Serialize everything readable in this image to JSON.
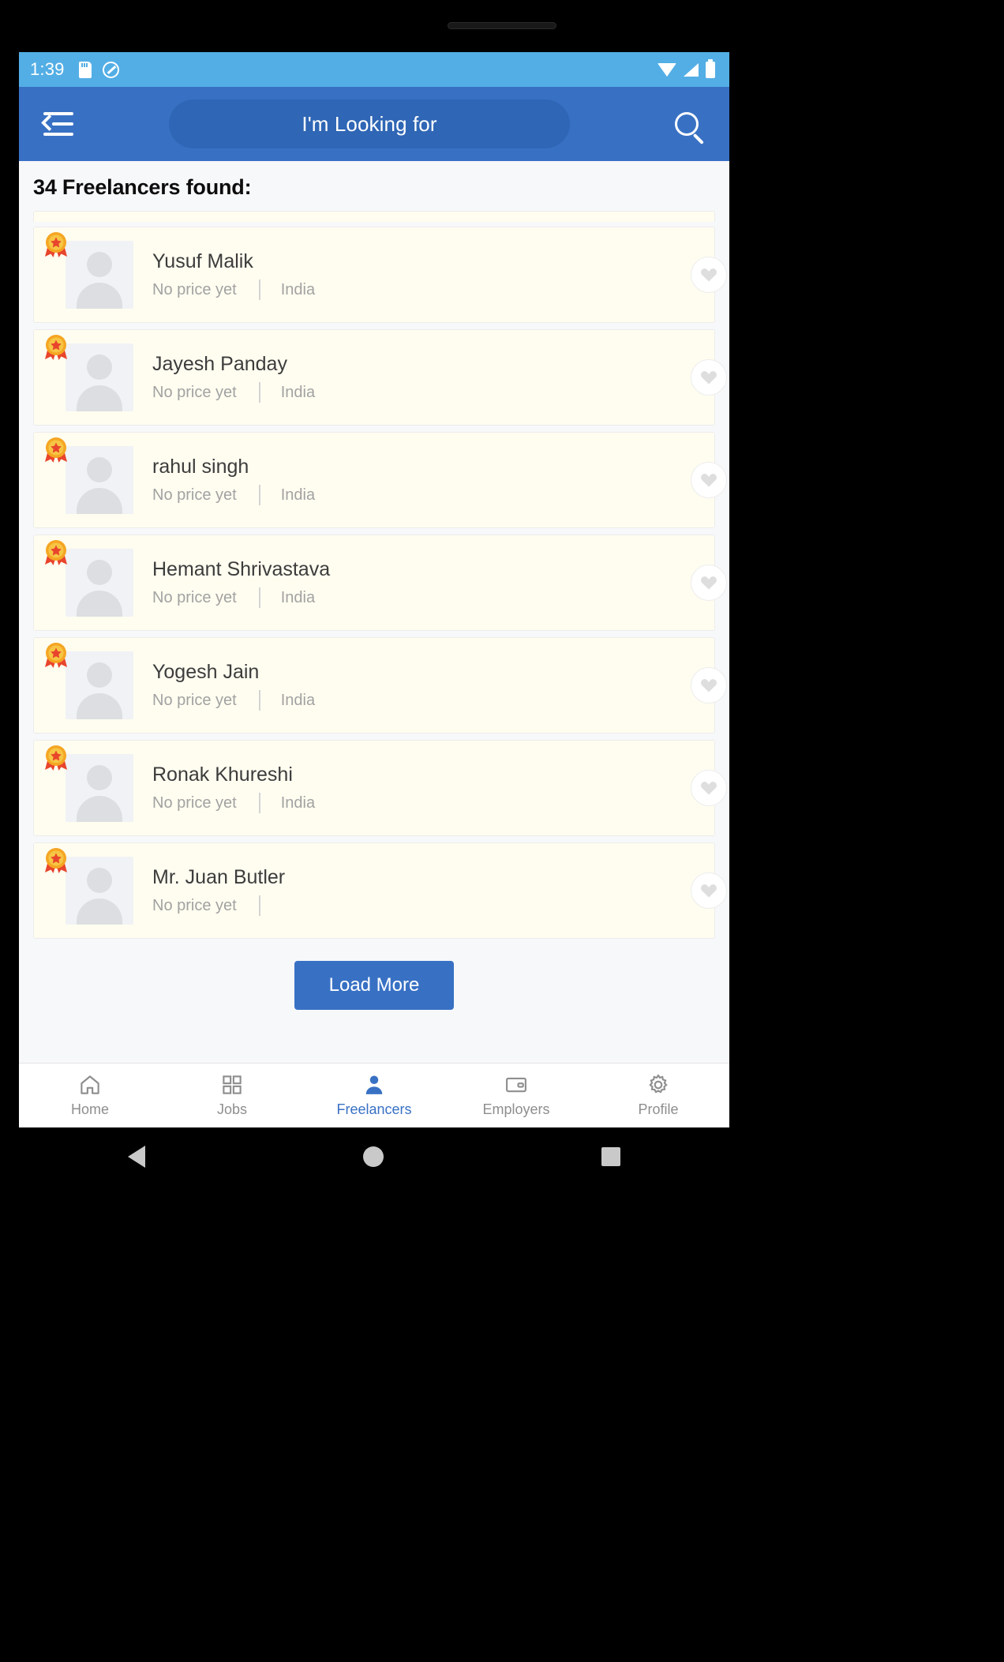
{
  "statusbar": {
    "time": "1:39",
    "icons": [
      "sd-card-icon",
      "do-not-disturb-icon",
      "wifi-icon",
      "cellular-signal-icon",
      "battery-icon"
    ]
  },
  "appbar": {
    "menu_icon": "menu-back-icon",
    "search_placeholder": "I'm Looking for",
    "search_icon": "search-icon"
  },
  "results": {
    "heading": "34 Freelancers found:"
  },
  "freelancers": [
    {
      "name": "Yusuf Malik",
      "price": "No price yet",
      "location": "India",
      "badge": "award-medal-icon",
      "favorite_icon": "heart-icon"
    },
    {
      "name": "Jayesh Panday",
      "price": "No price yet",
      "location": "India",
      "badge": "award-medal-icon",
      "favorite_icon": "heart-icon"
    },
    {
      "name": "rahul singh",
      "price": "No price yet",
      "location": "India",
      "badge": "award-medal-icon",
      "favorite_icon": "heart-icon"
    },
    {
      "name": "Hemant  Shrivastava",
      "price": "No price yet",
      "location": "India",
      "badge": "award-medal-icon",
      "favorite_icon": "heart-icon"
    },
    {
      "name": "Yogesh Jain",
      "price": "No price yet",
      "location": "India",
      "badge": "award-medal-icon",
      "favorite_icon": "heart-icon"
    },
    {
      "name": "Ronak Khureshi",
      "price": "No price yet",
      "location": "India",
      "badge": "award-medal-icon",
      "favorite_icon": "heart-icon"
    },
    {
      "name": "Mr. Juan Butler",
      "price": "No price yet",
      "location": "",
      "badge": "award-medal-icon",
      "favorite_icon": "heart-icon"
    }
  ],
  "load_more": {
    "label": "Load More"
  },
  "bottomnav": {
    "active": "Freelancers",
    "items": [
      {
        "label": "Home",
        "icon": "home-icon"
      },
      {
        "label": "Jobs",
        "icon": "grid-icon"
      },
      {
        "label": "Freelancers",
        "icon": "person-icon"
      },
      {
        "label": "Employers",
        "icon": "card-icon"
      },
      {
        "label": "Profile",
        "icon": "gear-icon"
      }
    ]
  },
  "colors": {
    "statusbar": "#53aee5",
    "appbar": "#3871c4",
    "accent": "#3871c4",
    "card_bg": "#fffdf0",
    "page_bg": "#f7f8fa"
  },
  "system_nav": {
    "back": "back-triangle-icon",
    "home": "home-circle-icon",
    "recents": "recents-square-icon"
  }
}
